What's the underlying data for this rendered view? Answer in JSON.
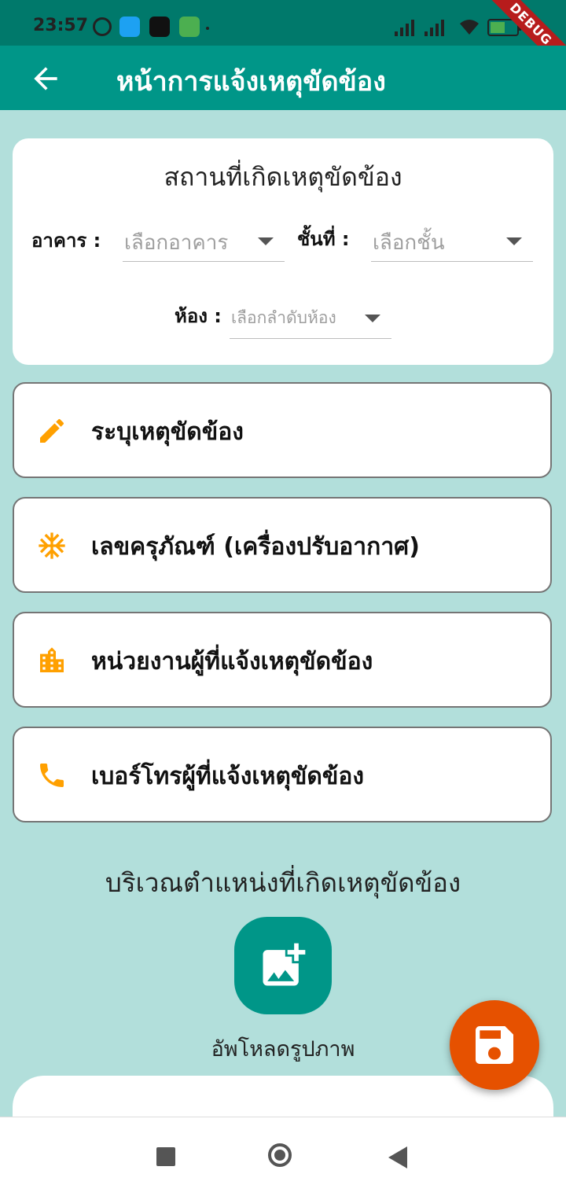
{
  "status_bar": {
    "time": "23:57",
    "debug_label": "DEBUG",
    "colors": {
      "background": "#00796b"
    }
  },
  "app_bar": {
    "title": "หน้าการแจ้งเหตุขัดข้อง",
    "back_icon": "arrow-left-icon",
    "color": "#009688"
  },
  "location_card": {
    "title": "สถานที่เกิดเหตุขัดข้อง",
    "building": {
      "label": "อาคาร :",
      "placeholder": "เลือกอาคาร"
    },
    "floor": {
      "label": "ชั้นที่ :",
      "placeholder": "เลือกชั้น"
    },
    "room": {
      "label": "ห้อง :",
      "placeholder": "เลือกลำดับห้อง"
    }
  },
  "menu_items": [
    {
      "label": "ระบุเหตุขัดข้อง",
      "icon": "pencil-icon"
    },
    {
      "label": "เลขครุภัณฑ์ (เครื่องปรับอากาศ)",
      "icon": "snowflake-icon"
    },
    {
      "label": "หน่วยงานผู้ที่แจ้งเหตุขัดข้อง",
      "icon": "building-icon"
    },
    {
      "label": "เบอร์โทรผู้ที่แจ้งเหตุขัดข้อง",
      "icon": "phone-icon"
    }
  ],
  "photo_section": {
    "title": "บริเวณตำแหน่งที่เกิดเหตุขัดข้อง",
    "upload_label": "อัพโหลดรูปภาพ",
    "upload_icon": "add-photo-icon"
  },
  "fab": {
    "icon": "save-icon",
    "color": "#e65100"
  },
  "colors": {
    "accent": "#009688",
    "icon_orange": "#ffa000",
    "background": "#b2dfdb"
  }
}
